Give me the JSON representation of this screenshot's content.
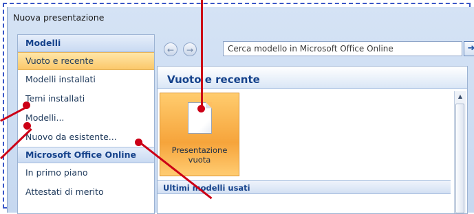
{
  "window": {
    "title": "Nuova presentazione"
  },
  "left_panel": {
    "header": "Modelli",
    "items": [
      {
        "label": "Vuoto e recente",
        "selected": true
      },
      {
        "label": "Modelli installati",
        "selected": false
      },
      {
        "label": "Temi installati",
        "selected": false
      },
      {
        "label": "Modelli...",
        "selected": false
      },
      {
        "label": "Nuovo da esistente...",
        "selected": false
      }
    ],
    "online_header": "Microsoft Office Online",
    "online_items": [
      {
        "label": "In primo piano"
      },
      {
        "label": "Attestati di merito"
      }
    ]
  },
  "toolbar": {
    "back_icon": "back-arrow-icon",
    "forward_icon": "forward-arrow-icon",
    "search_value": "Cerca modello in Microsoft Office Online",
    "go_icon": "arrow-right-icon"
  },
  "main": {
    "header": "Vuoto e recente",
    "tile": {
      "line1": "Presentazione",
      "line2": "vuota",
      "icon": "blank-document-icon"
    },
    "subheader": "Ultimi modelli usati"
  },
  "colors": {
    "accent_orange": "#f6a43b",
    "header_blue": "#15428b",
    "annotation_red": "#cc0016",
    "dashed_border": "#3a57c8"
  }
}
